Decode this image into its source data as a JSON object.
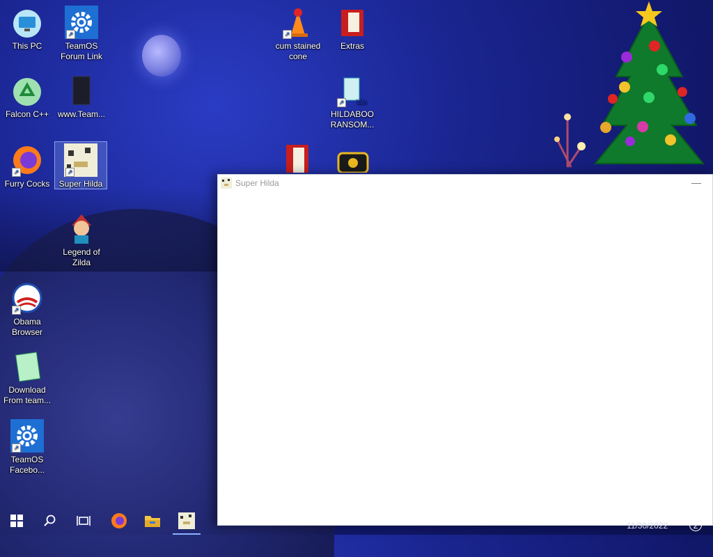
{
  "desktop": {
    "icons": [
      {
        "label": "This PC"
      },
      {
        "label": "TeamOS Forum Link"
      },
      {
        "label": "Falcon C++"
      },
      {
        "label": "www.Team..."
      },
      {
        "label": "Furry Cocks"
      },
      {
        "label": "Super Hilda"
      },
      {
        "label": "Legend of Zilda"
      },
      {
        "label": "Obama Browser"
      },
      {
        "label": "Download From team..."
      },
      {
        "label": "TeamOS Facebo..."
      },
      {
        "label": "cum stained cone"
      },
      {
        "label": "Extras"
      },
      {
        "label": "HILDABOO RANSOM..."
      }
    ]
  },
  "window": {
    "title": "Super Hilda",
    "minimize_glyph": "—"
  },
  "taskbar": {
    "clock": "11/30/2022",
    "notifications": "2"
  }
}
